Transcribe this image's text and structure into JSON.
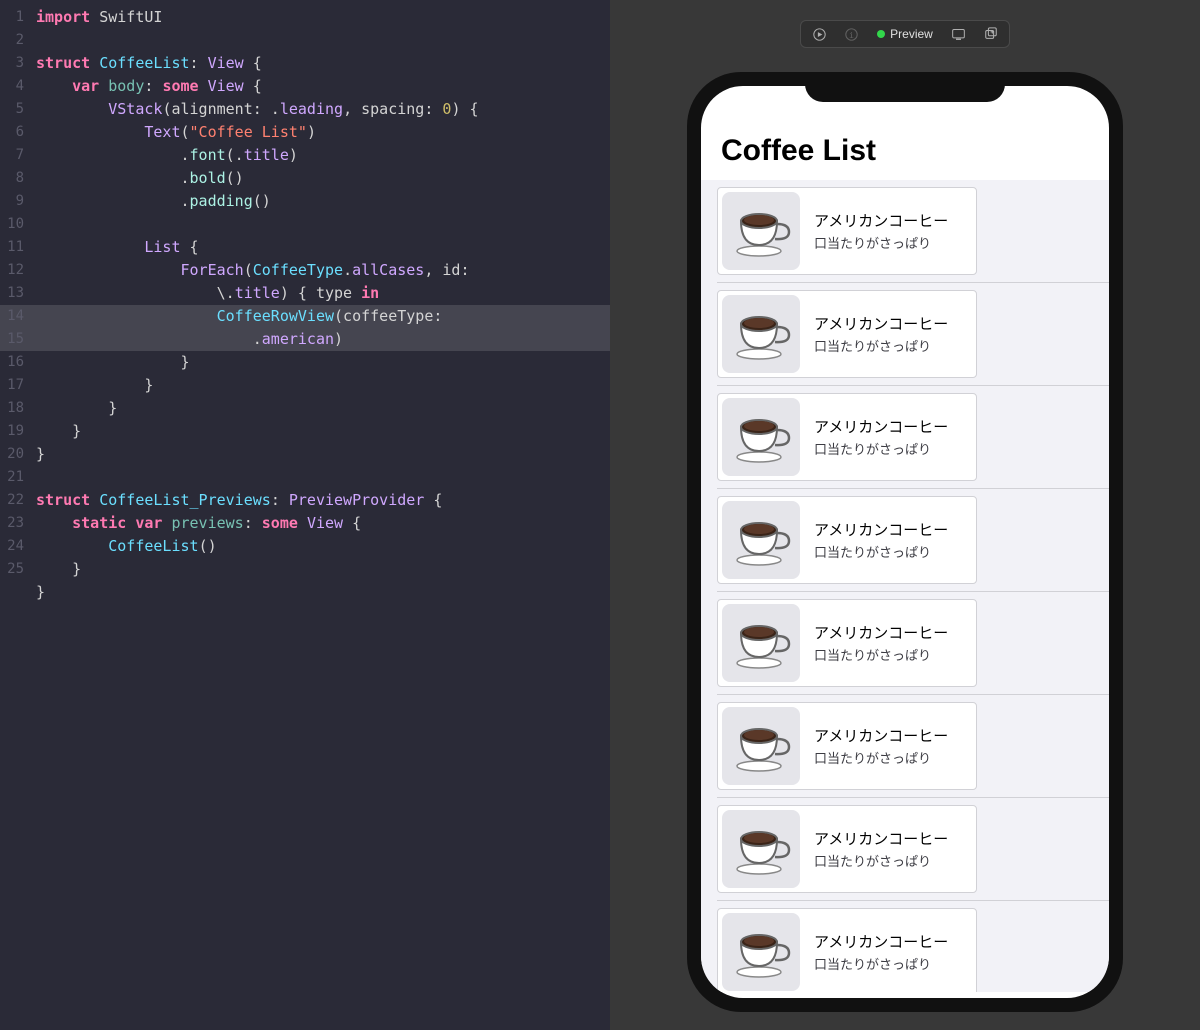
{
  "editor": {
    "lines": 25,
    "highlight_line_index": 12,
    "tokens": [
      [
        {
          "t": "import ",
          "c": "tok-keyword"
        },
        {
          "t": "SwiftUI",
          "c": "tok-plain"
        }
      ],
      [],
      [
        {
          "t": "struct ",
          "c": "tok-keyword"
        },
        {
          "t": "CoffeeList",
          "c": "tok-type"
        },
        {
          "t": ": ",
          "c": "tok-plain"
        },
        {
          "t": "View",
          "c": "tok-prop"
        },
        {
          "t": " {",
          "c": "tok-plain"
        }
      ],
      [
        {
          "t": "    ",
          "c": ""
        },
        {
          "t": "var ",
          "c": "tok-keyword"
        },
        {
          "t": "body",
          "c": "tok-var"
        },
        {
          "t": ": ",
          "c": "tok-plain"
        },
        {
          "t": "some ",
          "c": "tok-keyword"
        },
        {
          "t": "View",
          "c": "tok-prop"
        },
        {
          "t": " {",
          "c": "tok-plain"
        }
      ],
      [
        {
          "t": "        ",
          "c": ""
        },
        {
          "t": "VStack",
          "c": "tok-prop"
        },
        {
          "t": "(alignment: .",
          "c": "tok-plain"
        },
        {
          "t": "leading",
          "c": "tok-prop"
        },
        {
          "t": ", spacing: ",
          "c": "tok-plain"
        },
        {
          "t": "0",
          "c": "tok-number"
        },
        {
          "t": ") {",
          "c": "tok-plain"
        }
      ],
      [
        {
          "t": "            ",
          "c": ""
        },
        {
          "t": "Text",
          "c": "tok-prop"
        },
        {
          "t": "(",
          "c": "tok-plain"
        },
        {
          "t": "\"Coffee List\"",
          "c": "tok-string"
        },
        {
          "t": ")",
          "c": "tok-plain"
        }
      ],
      [
        {
          "t": "                .",
          "c": "tok-plain"
        },
        {
          "t": "font",
          "c": "tok-func"
        },
        {
          "t": "(.",
          "c": "tok-plain"
        },
        {
          "t": "title",
          "c": "tok-prop"
        },
        {
          "t": ")",
          "c": "tok-plain"
        }
      ],
      [
        {
          "t": "                .",
          "c": "tok-plain"
        },
        {
          "t": "bold",
          "c": "tok-func"
        },
        {
          "t": "()",
          "c": "tok-plain"
        }
      ],
      [
        {
          "t": "                .",
          "c": "tok-plain"
        },
        {
          "t": "padding",
          "c": "tok-func"
        },
        {
          "t": "()",
          "c": "tok-plain"
        }
      ],
      [],
      [
        {
          "t": "            ",
          "c": ""
        },
        {
          "t": "List",
          "c": "tok-prop"
        },
        {
          "t": " {",
          "c": "tok-plain"
        }
      ],
      [
        {
          "t": "                ",
          "c": ""
        },
        {
          "t": "ForEach",
          "c": "tok-prop"
        },
        {
          "t": "(",
          "c": "tok-plain"
        },
        {
          "t": "CoffeeType",
          "c": "tok-type"
        },
        {
          "t": ".",
          "c": "tok-plain"
        },
        {
          "t": "allCases",
          "c": "tok-prop"
        },
        {
          "t": ", id:",
          "c": "tok-plain"
        }
      ],
      [
        {
          "t": "                    \\.",
          "c": "tok-plain"
        },
        {
          "t": "title",
          "c": "tok-prop"
        },
        {
          "t": ") { type ",
          "c": "tok-plain"
        },
        {
          "t": "in",
          "c": "tok-in"
        }
      ],
      [
        {
          "t": "                    ",
          "c": ""
        },
        {
          "t": "CoffeeRowView",
          "c": "tok-type"
        },
        {
          "t": "(coffeeType:",
          "c": "tok-plain"
        }
      ],
      [
        {
          "t": "                        .",
          "c": "tok-plain"
        },
        {
          "t": "american",
          "c": "tok-prop"
        },
        {
          "t": ")",
          "c": "tok-plain"
        }
      ],
      [
        {
          "t": "                }",
          "c": "tok-plain"
        }
      ],
      [
        {
          "t": "            }",
          "c": "tok-plain"
        }
      ],
      [
        {
          "t": "        }",
          "c": "tok-plain"
        }
      ],
      [
        {
          "t": "    }",
          "c": "tok-plain"
        }
      ],
      [
        {
          "t": "}",
          "c": "tok-plain"
        }
      ],
      [],
      [
        {
          "t": "struct ",
          "c": "tok-keyword"
        },
        {
          "t": "CoffeeList_Previews",
          "c": "tok-type"
        },
        {
          "t": ": ",
          "c": "tok-plain"
        },
        {
          "t": "PreviewProvider",
          "c": "tok-prop"
        },
        {
          "t": " {",
          "c": "tok-plain"
        }
      ],
      [
        {
          "t": "    ",
          "c": ""
        },
        {
          "t": "static var ",
          "c": "tok-keyword"
        },
        {
          "t": "previews",
          "c": "tok-var"
        },
        {
          "t": ": ",
          "c": "tok-plain"
        },
        {
          "t": "some ",
          "c": "tok-keyword"
        },
        {
          "t": "View",
          "c": "tok-prop"
        },
        {
          "t": " {",
          "c": "tok-plain"
        }
      ],
      [
        {
          "t": "        ",
          "c": ""
        },
        {
          "t": "CoffeeList",
          "c": "tok-type"
        },
        {
          "t": "()",
          "c": "tok-plain"
        }
      ],
      [
        {
          "t": "    }",
          "c": "tok-plain"
        }
      ],
      [
        {
          "t": "}",
          "c": "tok-plain"
        }
      ]
    ],
    "gutter": [
      "1",
      "2",
      "3",
      "4",
      "5",
      "6",
      "7",
      "8",
      "9",
      "10",
      "11",
      "12",
      "",
      "13",
      "14",
      "15",
      "16",
      "17",
      "18",
      "19",
      "20",
      "21",
      "22",
      "23",
      "24",
      "25"
    ]
  },
  "toolbar": {
    "preview_label": "Preview"
  },
  "preview": {
    "title": "Coffee List",
    "rows": [
      {
        "title": "アメリカンコーヒー",
        "desc": "口当たりがさっぱり"
      },
      {
        "title": "アメリカンコーヒー",
        "desc": "口当たりがさっぱり"
      },
      {
        "title": "アメリカンコーヒー",
        "desc": "口当たりがさっぱり"
      },
      {
        "title": "アメリカンコーヒー",
        "desc": "口当たりがさっぱり"
      },
      {
        "title": "アメリカンコーヒー",
        "desc": "口当たりがさっぱり"
      },
      {
        "title": "アメリカンコーヒー",
        "desc": "口当たりがさっぱり"
      },
      {
        "title": "アメリカンコーヒー",
        "desc": "口当たりがさっぱり"
      },
      {
        "title": "アメリカンコーヒー",
        "desc": "口当たりがさっぱり"
      }
    ]
  }
}
